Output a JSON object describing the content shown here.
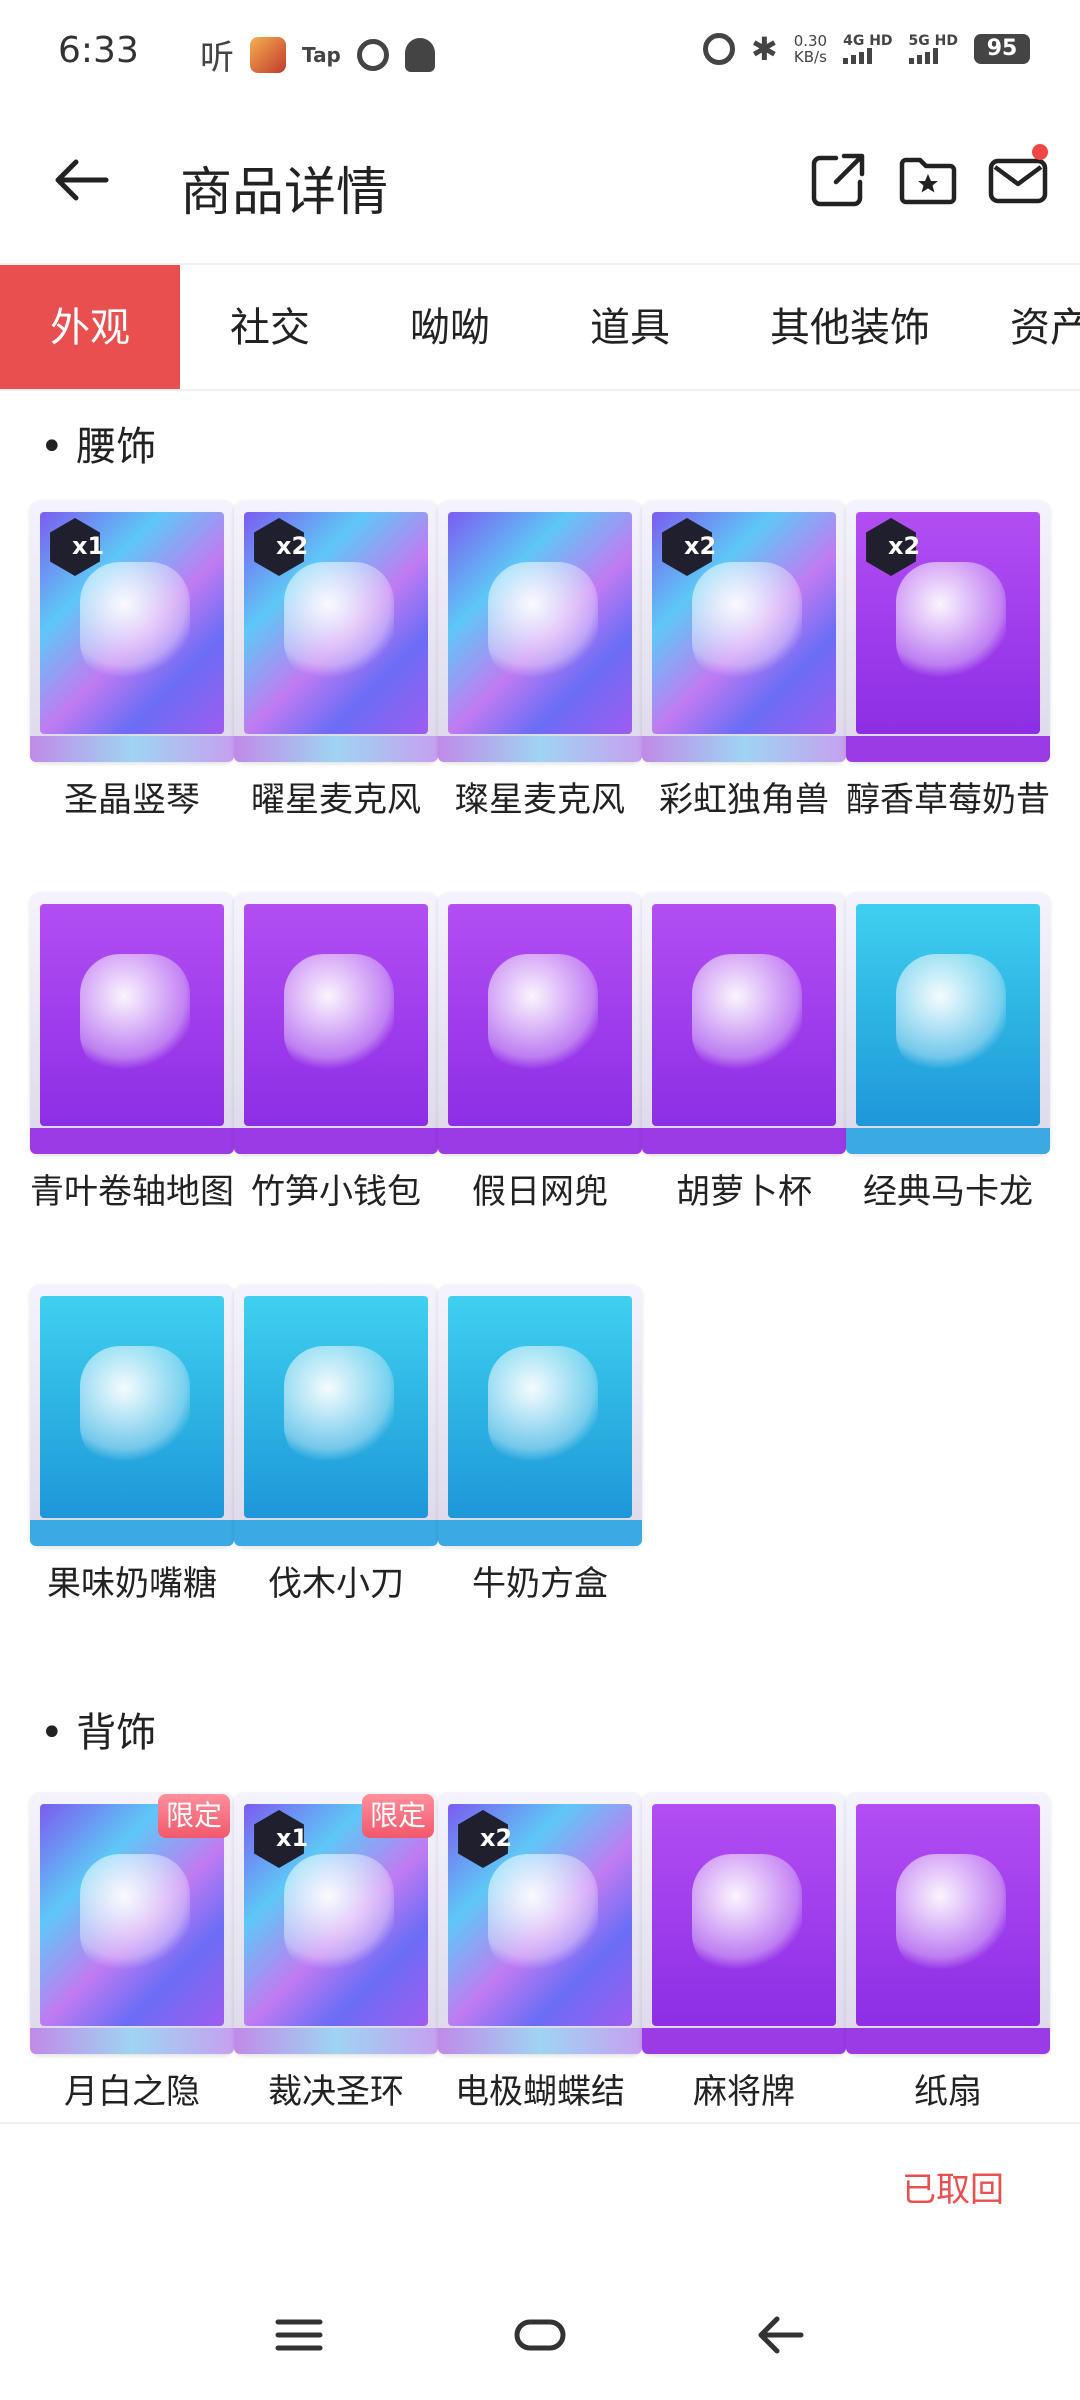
{
  "status_bar": {
    "time": "6:33",
    "ting_glyph": "听",
    "tap_label": "Tap",
    "net_speed_value": "0.30",
    "net_speed_unit": "KB/s",
    "net1_label": "4G HD",
    "net2_label": "5G HD",
    "battery": "95",
    "bluetooth_glyph": "✱"
  },
  "header": {
    "title": "商品详情"
  },
  "tabs": [
    {
      "label": "外观"
    },
    {
      "label": "社交"
    },
    {
      "label": "呦呦"
    },
    {
      "label": "道具"
    },
    {
      "label": "其他装饰"
    },
    {
      "label": "资产"
    }
  ],
  "active_tab": "外观",
  "sections": [
    {
      "title": "• 腰饰",
      "items": [
        {
          "name": "圣晶竖琴",
          "badge": "x1",
          "style": "holo"
        },
        {
          "name": "曜星麦克风",
          "badge": "x2",
          "style": "holo"
        },
        {
          "name": "璨星麦克风",
          "badge": "",
          "style": "holo"
        },
        {
          "name": "彩虹独角兽",
          "badge": "x2",
          "style": "holo"
        },
        {
          "name": "醇香草莓奶昔",
          "badge": "x2",
          "style": "purple"
        },
        {
          "name": "青叶卷轴地图",
          "badge": "",
          "style": "purple"
        },
        {
          "name": "竹笋小钱包",
          "badge": "",
          "style": "purple"
        },
        {
          "name": "假日网兜",
          "badge": "",
          "style": "purple"
        },
        {
          "name": "胡萝卜杯",
          "badge": "",
          "style": "purple"
        },
        {
          "name": "经典马卡龙",
          "badge": "",
          "style": "blue"
        },
        {
          "name": "果味奶嘴糖",
          "badge": "",
          "style": "blue"
        },
        {
          "name": "伐木小刀",
          "badge": "",
          "style": "blue"
        },
        {
          "name": "牛奶方盒",
          "badge": "",
          "style": "blue"
        }
      ]
    },
    {
      "title": "• 背饰",
      "items": [
        {
          "name": "月白之隐",
          "badge": "",
          "limited": "限定",
          "style": "holo"
        },
        {
          "name": "裁决圣环",
          "badge": "x1",
          "limited": "限定",
          "style": "holo"
        },
        {
          "name": "电极蝴蝶结",
          "badge": "x2",
          "style": "holo"
        },
        {
          "name": "麻将牌",
          "badge": "",
          "style": "purple"
        },
        {
          "name": "纸扇",
          "badge": "",
          "style": "purple"
        }
      ]
    }
  ],
  "footer": {
    "status": "已取回"
  },
  "icons": {
    "back": "arrow-left-icon",
    "share": "share-icon",
    "folder": "folder-star-icon",
    "mail": "mail-icon",
    "nav_menu": "menu-icon",
    "nav_home": "home-icon",
    "nav_back": "back-icon"
  },
  "colors": {
    "accent": "#e8504f",
    "holo": "#7b5cf0",
    "purple": "#9a3be6",
    "blue": "#3ba9e3",
    "text": "#222222"
  }
}
